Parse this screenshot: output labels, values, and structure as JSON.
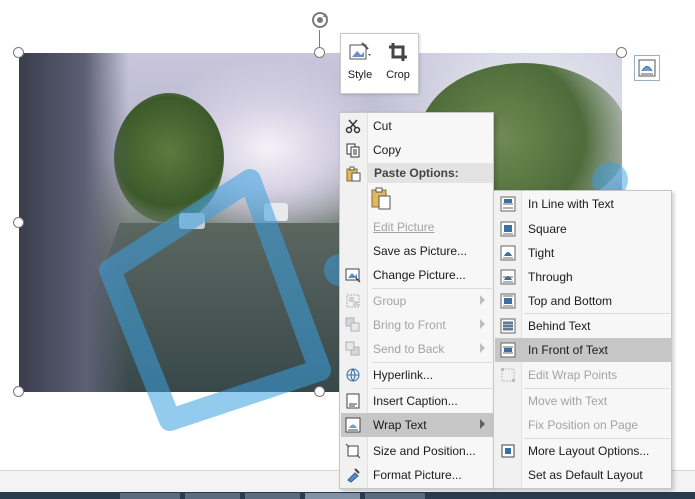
{
  "mini_toolbar": {
    "style_label": "Style",
    "crop_label": "Crop"
  },
  "context_menu": {
    "cut": "Cut",
    "copy": "Copy",
    "paste_options": "Paste Options:",
    "edit_picture": "Edit Picture",
    "save_as_picture": "Save as Picture...",
    "change_picture": "Change Picture...",
    "group": "Group",
    "bring_to_front": "Bring to Front",
    "send_to_back": "Send to Back",
    "hyperlink": "Hyperlink...",
    "insert_caption": "Insert Caption...",
    "wrap_text": "Wrap Text",
    "size_and_position": "Size and Position...",
    "format_picture": "Format Picture..."
  },
  "wrap_submenu": {
    "in_line_with_text": "In Line with Text",
    "square": "Square",
    "tight": "Tight",
    "through": "Through",
    "top_and_bottom": "Top and Bottom",
    "behind_text": "Behind Text",
    "in_front_of_text": "In Front of Text",
    "edit_wrap_points": "Edit Wrap Points",
    "move_with_text": "Move with Text",
    "fix_position_on_page": "Fix Position on Page",
    "more_layout_options": "More Layout Options...",
    "set_as_default_layout": "Set as Default Layout"
  },
  "colors": {
    "menu_bg": "#f7f7f7",
    "highlight": "#c6c6c6",
    "disabled_text": "#a3a3a3",
    "watermark": "#3aa0e0"
  }
}
